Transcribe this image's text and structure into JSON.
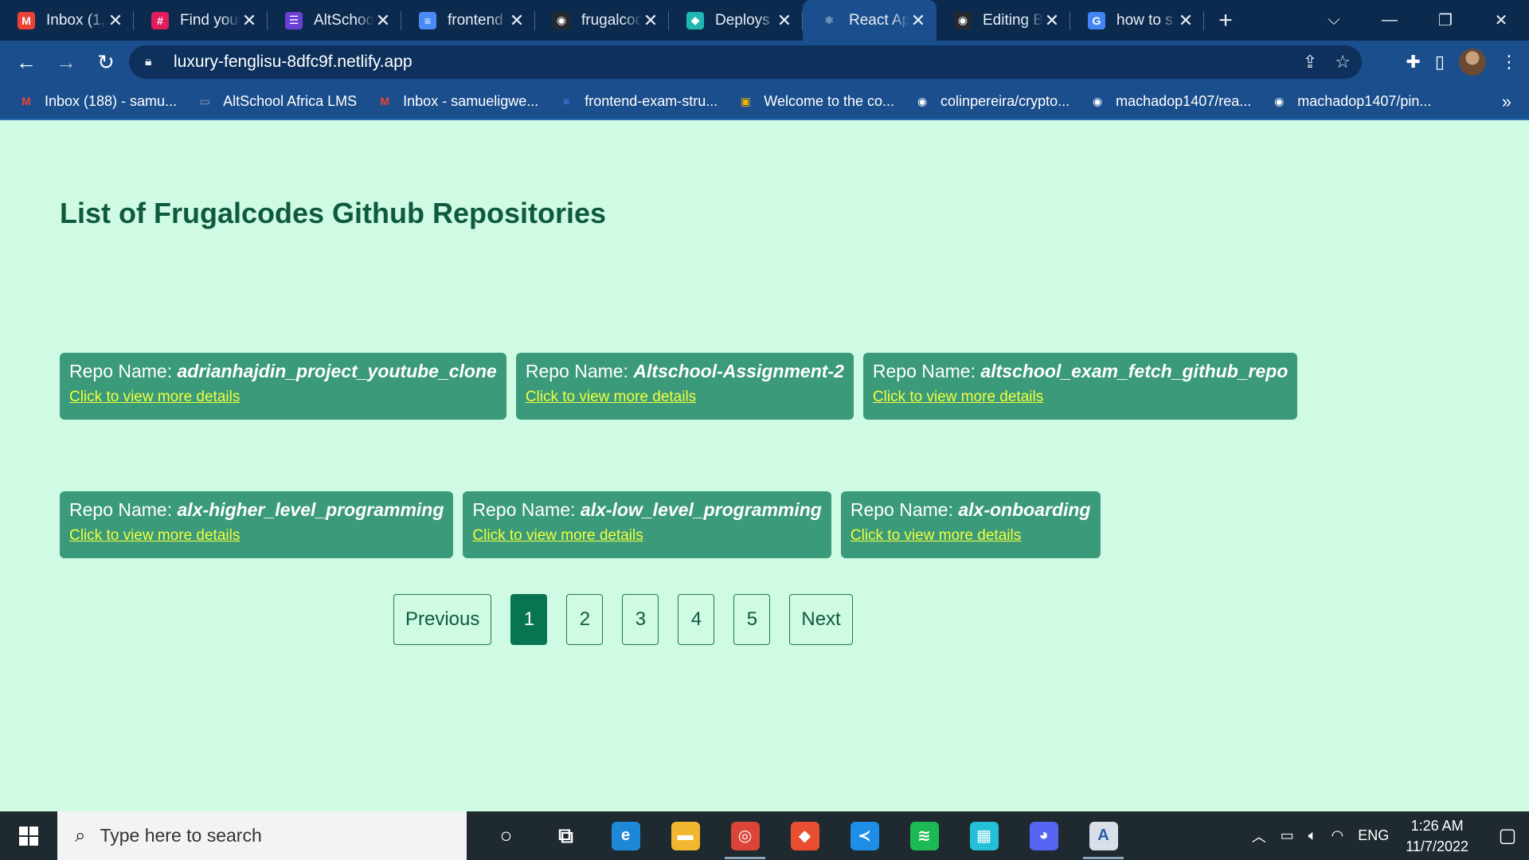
{
  "tabs": [
    {
      "title": "Inbox (1,",
      "icon": "gmail-icon",
      "fav": "M",
      "color": "#ea4335",
      "active": false
    },
    {
      "title": "Find your",
      "icon": "slack-icon",
      "fav": "#",
      "color": "#e01e5a",
      "active": false
    },
    {
      "title": "AltSchool",
      "icon": "altschool-icon",
      "fav": "☰",
      "color": "#6a3fd4",
      "active": false
    },
    {
      "title": "frontend",
      "icon": "docs-icon",
      "fav": "≡",
      "color": "#4a8af4",
      "active": false
    },
    {
      "title": "frugalcode",
      "icon": "github-icon",
      "fav": "◉",
      "color": "#24292e",
      "active": false
    },
    {
      "title": "Deploys",
      "icon": "netlify-icon",
      "fav": "◆",
      "color": "#1fb8b0",
      "active": false
    },
    {
      "title": "React App",
      "icon": "react-icon",
      "fav": "⚛",
      "color": "#1b4e8c",
      "active": true
    },
    {
      "title": "Editing B",
      "icon": "github-icon",
      "fav": "◉",
      "color": "#24292e",
      "active": false
    },
    {
      "title": "how to s",
      "icon": "google-icon",
      "fav": "G",
      "color": "#4285f4",
      "active": false
    }
  ],
  "address": {
    "url": "luxury-fenglisu-8dfc9f.netlify.app"
  },
  "bookmarks": [
    {
      "label": "Inbox (188) - samu...",
      "icon": "gmail-icon",
      "fav": "M",
      "color": "#ea4335"
    },
    {
      "label": "AltSchool Africa LMS",
      "icon": "altschool-icon",
      "fav": "▭",
      "color": "#9aa8c0"
    },
    {
      "label": "Inbox - samueligwe...",
      "icon": "gmail-icon",
      "fav": "M",
      "color": "#ea4335"
    },
    {
      "label": "frontend-exam-stru...",
      "icon": "docs-icon",
      "fav": "≡",
      "color": "#4a8af4"
    },
    {
      "label": "Welcome to the co...",
      "icon": "course-icon",
      "fav": "▣",
      "color": "#f2b400"
    },
    {
      "label": "colinpereira/crypto...",
      "icon": "github-icon",
      "fav": "◉",
      "color": "#24292e"
    },
    {
      "label": "machadop1407/rea...",
      "icon": "github-icon",
      "fav": "◉",
      "color": "#24292e"
    },
    {
      "label": "machadop1407/pin...",
      "icon": "github-icon",
      "fav": "◉",
      "color": "#24292e"
    }
  ],
  "page": {
    "title": "List of Frugalcodes Github Repositories",
    "repo_prefix": "Repo Name: ",
    "repos_row1": [
      {
        "name": "adrianhajdin_project_youtube_clone",
        "link": "Click to view more details"
      },
      {
        "name": "Altschool-Assignment-2",
        "link": "Click to view more details"
      },
      {
        "name": "altschool_exam_fetch_github_repo",
        "link": "Click to view more details"
      }
    ],
    "repos_row2": [
      {
        "name": "alx-higher_level_programming",
        "link": "Click to view more details"
      },
      {
        "name": "alx-low_level_programming",
        "link": "Click to view more details"
      },
      {
        "name": "alx-onboarding",
        "link": "Click to view more details"
      }
    ],
    "pagination": {
      "previous": "Previous",
      "next": "Next",
      "pages": [
        "1",
        "2",
        "3",
        "4",
        "5"
      ],
      "current": "1"
    }
  },
  "taskbar": {
    "search_placeholder": "Type here to search",
    "apps": [
      {
        "name": "cortana-icon",
        "glyph": "○",
        "color": "transparent",
        "open": false
      },
      {
        "name": "task-view-icon",
        "glyph": "⧉",
        "color": "transparent",
        "open": false
      },
      {
        "name": "edge-icon",
        "glyph": "e",
        "color": "#1e88d8",
        "open": false
      },
      {
        "name": "file-explorer-icon",
        "glyph": "▬",
        "color": "#f2b630",
        "open": false
      },
      {
        "name": "chrome-icon",
        "glyph": "◎",
        "color": "#db4437",
        "open": true
      },
      {
        "name": "git-icon",
        "glyph": "◆",
        "color": "#e94e31",
        "open": false
      },
      {
        "name": "vscode-icon",
        "glyph": "≺",
        "color": "#1e8ee8",
        "open": false
      },
      {
        "name": "spotify-icon",
        "glyph": "≋",
        "color": "#1db954",
        "open": false
      },
      {
        "name": "app-icon",
        "glyph": "▦",
        "color": "#23c0d8",
        "open": false
      },
      {
        "name": "discord-icon",
        "glyph": "◕",
        "color": "#5865f2",
        "open": false
      },
      {
        "name": "editor-icon",
        "glyph": "A",
        "color": "#d8dfe8",
        "open": true
      }
    ],
    "language": "ENG",
    "time": "1:26 AM",
    "date": "11/7/2022"
  },
  "colors": {
    "page_bg": "#cffae3",
    "card_bg": "#3a9a7a",
    "link": "#f2ff3c",
    "title": "#0e5a3e",
    "active_page": "#087552"
  }
}
